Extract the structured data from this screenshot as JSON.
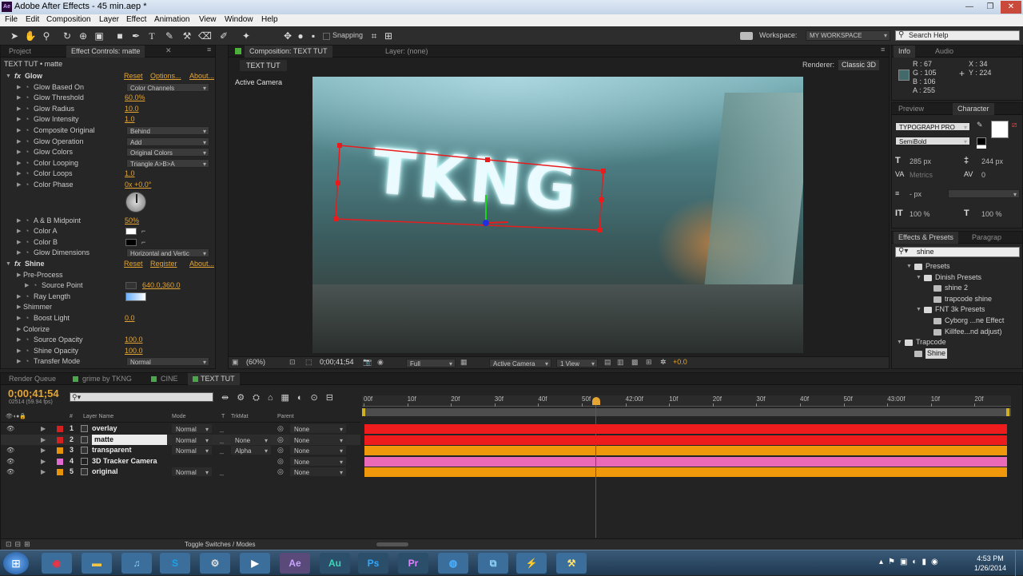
{
  "title": "Adobe After Effects - 45 min.aep *",
  "app_icon": "Ae",
  "menu": [
    "File",
    "Edit",
    "Composition",
    "Layer",
    "Effect",
    "Animation",
    "View",
    "Window",
    "Help"
  ],
  "toolbar": {
    "snapping": "Snapping",
    "workspace_label": "Workspace:",
    "workspace_value": "MY WORKSPACE",
    "search_placeholder": "Search Help"
  },
  "left_panel": {
    "tabs": [
      "Project",
      "Effect Controls: matte"
    ],
    "header": "TEXT TUT • matte",
    "glow": {
      "name": "Glow",
      "reset": "Reset",
      "options": "Options...",
      "about": "About...",
      "props": [
        {
          "label": "Glow Based On",
          "value": "Color Channels",
          "type": "dd"
        },
        {
          "label": "Glow Threshold",
          "value": "60.0%",
          "type": "val"
        },
        {
          "label": "Glow Radius",
          "value": "10.0",
          "type": "val"
        },
        {
          "label": "Glow Intensity",
          "value": "1.0",
          "type": "val"
        },
        {
          "label": "Composite Original",
          "value": "Behind",
          "type": "dd"
        },
        {
          "label": "Glow Operation",
          "value": "Add",
          "type": "dd"
        },
        {
          "label": "Glow Colors",
          "value": "Original Colors",
          "type": "dd"
        },
        {
          "label": "Color Looping",
          "value": "Triangle A>B>A",
          "type": "dd"
        },
        {
          "label": "Color Loops",
          "value": "1.0",
          "type": "val"
        },
        {
          "label": "Color Phase",
          "value": "0x +0.0°",
          "type": "val"
        }
      ],
      "props2": [
        {
          "label": "A & B Midpoint",
          "value": "50%",
          "type": "val"
        },
        {
          "label": "Color A",
          "value": "",
          "type": "swatch"
        },
        {
          "label": "Color B",
          "value": "",
          "type": "swatch"
        },
        {
          "label": "Glow Dimensions",
          "value": "Horizontal and Vertic",
          "type": "dd"
        }
      ]
    },
    "shine": {
      "name": "Shine",
      "reset": "Reset",
      "register": "Register",
      "about": "About...",
      "props": [
        {
          "label": "Pre-Process",
          "value": "",
          "type": "none",
          "indent": 1
        },
        {
          "label": "Source Point",
          "value": "640.0,360.0",
          "type": "val",
          "indent": 2
        },
        {
          "label": "Ray Length",
          "value": "",
          "type": "slider",
          "indent": 1
        },
        {
          "label": "Shimmer",
          "value": "",
          "type": "none",
          "indent": 1
        },
        {
          "label": "Boost Light",
          "value": "0.0",
          "type": "val",
          "indent": 1
        },
        {
          "label": "Colorize",
          "value": "",
          "type": "none",
          "indent": 1
        },
        {
          "label": "Source Opacity",
          "value": "100.0",
          "type": "val",
          "indent": 1
        },
        {
          "label": "Shine Opacity",
          "value": "100.0",
          "type": "val",
          "indent": 1
        },
        {
          "label": "Transfer Mode",
          "value": "Normal",
          "type": "dd",
          "indent": 1
        }
      ]
    }
  },
  "comp": {
    "tab": "Composition: TEXT TUT",
    "layer_tab": "Layer: (none)",
    "subtab": "TEXT TUT",
    "renderer_label": "Renderer:",
    "renderer": "Classic 3D",
    "camera": "Active Camera",
    "text_overlay": "TKNG",
    "bottom": {
      "zoom": "(60%)",
      "time": "0;00;41;54",
      "res": "Full",
      "view_cam": "Active Camera",
      "views": "1 View",
      "offset": "+0.0"
    }
  },
  "info": {
    "tabs": [
      "Info",
      "Audio"
    ],
    "r": "R : 67",
    "g": "G : 105",
    "b": "B : 106",
    "a": "A : 255",
    "x": "X : 34",
    "y": "Y : 224",
    "swatch": "#436a6a"
  },
  "character": {
    "tabs": [
      "Preview",
      "Character"
    ],
    "font": "TYPOGRAPH PRO",
    "style": "SemiBold",
    "size": "285 px",
    "leading": "244 px",
    "kern": "Metrics",
    "track": "0",
    "stroke": "- px",
    "vscale": "100 %",
    "hscale": "100 %"
  },
  "effects_presets": {
    "tabs": [
      "Effects & Presets",
      "Paragrap"
    ],
    "search": "shine",
    "tree": [
      {
        "label": "Presets",
        "level": 1,
        "type": "folder"
      },
      {
        "label": "Dinish Presets",
        "level": 2,
        "type": "folder"
      },
      {
        "label": "shine 2",
        "level": 3,
        "type": "item"
      },
      {
        "label": "trapcode shine",
        "level": 3,
        "type": "item"
      },
      {
        "label": "FNT 3k Presets",
        "level": 2,
        "type": "folder"
      },
      {
        "label": "Cyborg ...ne Effect",
        "level": 3,
        "type": "item"
      },
      {
        "label": "Killfee...nd adjust)",
        "level": 3,
        "type": "item"
      },
      {
        "label": "Trapcode",
        "level": 0,
        "type": "folder"
      },
      {
        "label": "Shine",
        "level": 1,
        "type": "item",
        "selected": true
      }
    ]
  },
  "timeline": {
    "tabs": [
      "Render Queue",
      "grime by TKNG",
      "CINE",
      "TEXT TUT"
    ],
    "tab_colors": [
      "",
      "#4ca64c",
      "#4ca64c",
      "#4ca64c"
    ],
    "timecode": "0;00;41;54",
    "fps": "02514 (59.94 fps)",
    "headers": {
      "name": "Layer Name",
      "mode": "Mode",
      "t": "T",
      "trkmat": "TrkMat",
      "parent": "Parent"
    },
    "layers": [
      {
        "num": "1",
        "name": "overlay",
        "mode": "Normal",
        "trkmat": "",
        "parent": "None",
        "color": "#d42020"
      },
      {
        "num": "2",
        "name": "matte",
        "mode": "Normal",
        "trkmat": "None",
        "parent": "None",
        "color": "#d42020"
      },
      {
        "num": "3",
        "name": "transparent",
        "mode": "Normal",
        "trkmat": "Alpha",
        "parent": "None",
        "color": "#e8940a"
      },
      {
        "num": "4",
        "name": "3D Tracker Camera",
        "mode": "",
        "trkmat": "",
        "parent": "None",
        "color": "#e06ad0"
      },
      {
        "num": "5",
        "name": "original",
        "mode": "Normal",
        "trkmat": "",
        "parent": "None",
        "color": "#e8940a"
      }
    ],
    "track_colors": [
      "#ee1c1c",
      "#ee1c1c",
      "#f0980c",
      "#ea6ab8",
      "#f0980c"
    ],
    "ruler": [
      "00f",
      "10f",
      "20f",
      "30f",
      "40f",
      "50f",
      "42:00f",
      "10f",
      "20f",
      "30f",
      "40f",
      "50f",
      "43:00f",
      "10f",
      "20f"
    ],
    "toggle": "Toggle Switches / Modes"
  },
  "taskbar": {
    "time": "4:53 PM",
    "date": "1/26/2014",
    "apps": [
      "start",
      "chrome",
      "explorer",
      "itunes",
      "skype",
      "steam",
      "media",
      "Ae",
      "Au",
      "Ps",
      "Pr",
      "globe",
      "kinect",
      "zap",
      "tool"
    ]
  }
}
